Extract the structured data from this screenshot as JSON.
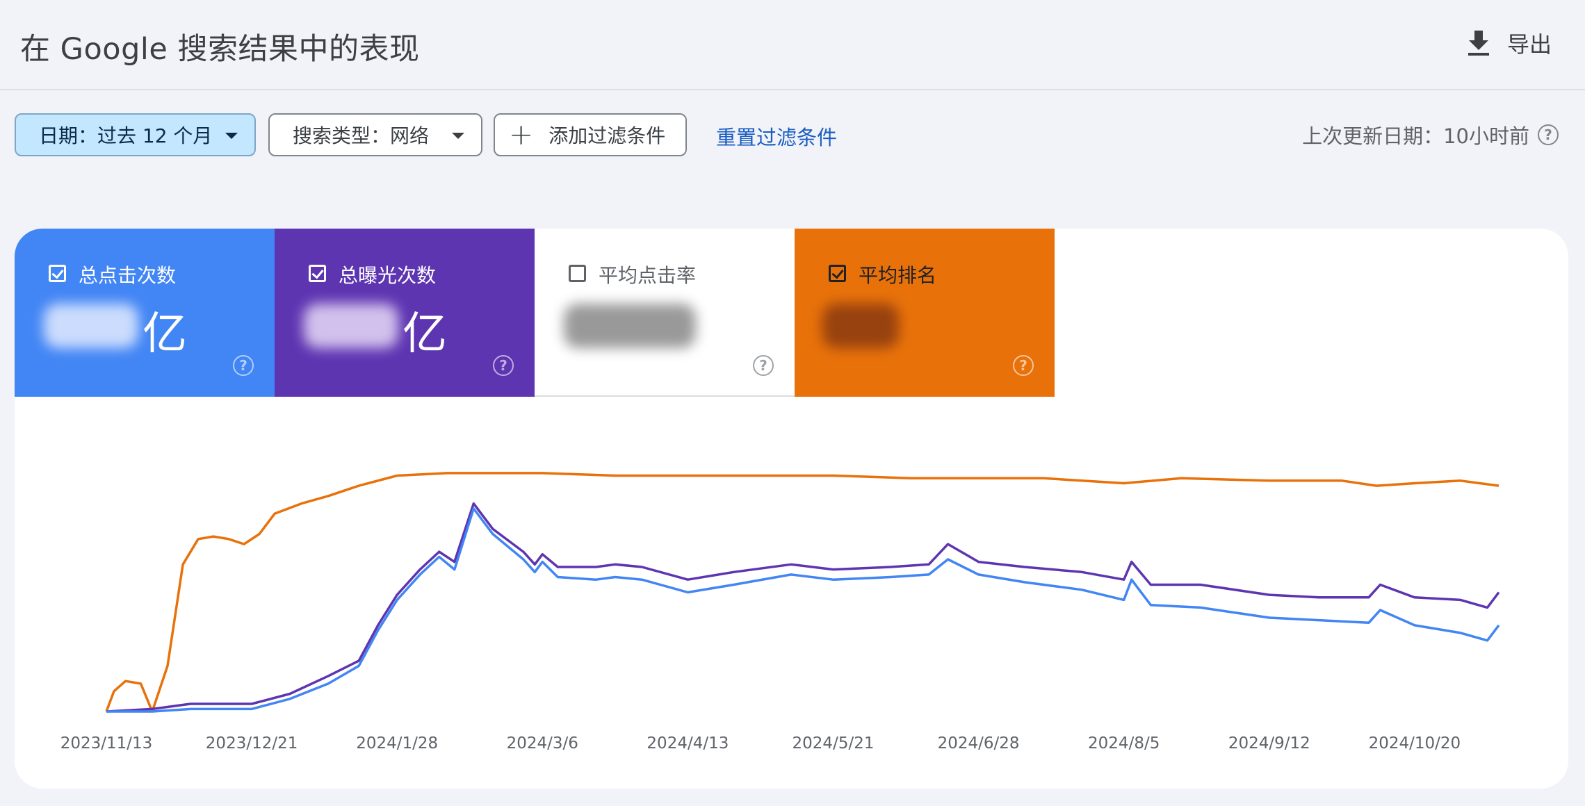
{
  "header": {
    "title": "在 Google 搜索结果中的表现",
    "export_label": "导出"
  },
  "filters": {
    "date_label": "日期：过去 12 个月",
    "search_type_label": "搜索类型：网络",
    "add_filter_label": "添加过滤条件",
    "reset_label": "重置过滤条件",
    "last_updated": "上次更新日期：10小时前"
  },
  "metrics": [
    {
      "label": "总点击次数",
      "unit": "亿",
      "checked": true,
      "color": "#4285f4"
    },
    {
      "label": "总曝光次数",
      "unit": "亿",
      "checked": true,
      "color": "#5e35b1"
    },
    {
      "label": "平均点击率",
      "unit": "",
      "checked": false,
      "color": "#ffffff"
    },
    {
      "label": "平均排名",
      "unit": "",
      "checked": true,
      "color": "#e8710a"
    }
  ],
  "icons": {
    "export": "download-icon",
    "add": "plus-icon",
    "help": "help-circle-icon",
    "checkbox": "checkbox-icon",
    "dropdown": "caret-down-icon"
  },
  "chart_data": {
    "type": "line",
    "x_tick_labels": [
      "2023/11/13",
      "2023/12/21",
      "2024/1/28",
      "2024/3/6",
      "2024/4/13",
      "2024/5/21",
      "2024/6/28",
      "2024/8/5",
      "2024/9/12",
      "2024/10/20"
    ],
    "x_range": [
      "2023/11/13",
      "2024/11/11"
    ],
    "y_axis_visible": false,
    "grid": false,
    "note_on_y": "relative scale 0-100, axes not labeled",
    "series": [
      {
        "color": "#e8710a",
        "points": [
          [
            "2023/11/13",
            0
          ],
          [
            "2023/11/15",
            8
          ],
          [
            "2023/11/18",
            12
          ],
          [
            "2023/11/22",
            11
          ],
          [
            "2023/11/25",
            0
          ],
          [
            "2023/11/29",
            18
          ],
          [
            "2023/12/3",
            58
          ],
          [
            "2023/12/7",
            68
          ],
          [
            "2023/12/11",
            69
          ],
          [
            "2023/12/15",
            68
          ],
          [
            "2023/12/19",
            66
          ],
          [
            "2023/12/23",
            70
          ],
          [
            "2023/12/27",
            78
          ],
          [
            "2024/1/3",
            82
          ],
          [
            "2024/1/10",
            85
          ],
          [
            "2024/1/18",
            89
          ],
          [
            "2024/1/28",
            93
          ],
          [
            "2024/2/10",
            94
          ],
          [
            "2024/2/25",
            94
          ],
          [
            "2024/3/6",
            94
          ],
          [
            "2024/3/25",
            93
          ],
          [
            "2024/4/13",
            93
          ],
          [
            "2024/5/3",
            93
          ],
          [
            "2024/5/21",
            93
          ],
          [
            "2024/6/10",
            92
          ],
          [
            "2024/6/28",
            92
          ],
          [
            "2024/7/15",
            92
          ],
          [
            "2024/7/25",
            91
          ],
          [
            "2024/8/5",
            90
          ],
          [
            "2024/8/20",
            92
          ],
          [
            "2024/9/12",
            91
          ],
          [
            "2024/10/1",
            91
          ],
          [
            "2024/10/10",
            89
          ],
          [
            "2024/10/20",
            90
          ],
          [
            "2024/11/1",
            91
          ],
          [
            "2024/11/11",
            89
          ]
        ]
      },
      {
        "color": "#5e35b1",
        "points": [
          [
            "2023/11/13",
            0
          ],
          [
            "2023/11/25",
            1
          ],
          [
            "2023/12/5",
            3
          ],
          [
            "2023/12/21",
            3
          ],
          [
            "2023/12/31",
            7
          ],
          [
            "2024/1/10",
            14
          ],
          [
            "2024/1/18",
            20
          ],
          [
            "2024/1/23",
            34
          ],
          [
            "2024/1/28",
            46
          ],
          [
            "2024/2/3",
            56
          ],
          [
            "2024/2/8",
            63
          ],
          [
            "2024/2/12",
            59
          ],
          [
            "2024/2/17",
            82
          ],
          [
            "2024/2/22",
            72
          ],
          [
            "2024/3/1",
            63
          ],
          [
            "2024/3/4",
            58
          ],
          [
            "2024/3/6",
            62
          ],
          [
            "2024/3/10",
            57
          ],
          [
            "2024/3/20",
            57
          ],
          [
            "2024/3/25",
            58
          ],
          [
            "2024/4/1",
            57
          ],
          [
            "2024/4/13",
            52
          ],
          [
            "2024/4/25",
            55
          ],
          [
            "2024/5/10",
            58
          ],
          [
            "2024/5/21",
            56
          ],
          [
            "2024/6/5",
            57
          ],
          [
            "2024/6/15",
            58
          ],
          [
            "2024/6/20",
            66
          ],
          [
            "2024/6/28",
            59
          ],
          [
            "2024/7/10",
            57
          ],
          [
            "2024/7/25",
            55
          ],
          [
            "2024/8/5",
            52
          ],
          [
            "2024/8/7",
            59
          ],
          [
            "2024/8/12",
            50
          ],
          [
            "2024/8/25",
            50
          ],
          [
            "2024/9/12",
            46
          ],
          [
            "2024/9/25",
            45
          ],
          [
            "2024/10/8",
            45
          ],
          [
            "2024/10/11",
            50
          ],
          [
            "2024/10/20",
            45
          ],
          [
            "2024/11/1",
            44
          ],
          [
            "2024/11/8",
            41
          ],
          [
            "2024/11/11",
            47
          ]
        ]
      },
      {
        "color": "#4285f4",
        "points": [
          [
            "2023/11/13",
            0
          ],
          [
            "2023/11/25",
            0
          ],
          [
            "2023/12/5",
            1
          ],
          [
            "2023/12/21",
            1
          ],
          [
            "2023/12/31",
            5
          ],
          [
            "2024/1/10",
            11
          ],
          [
            "2024/1/18",
            18
          ],
          [
            "2024/1/23",
            32
          ],
          [
            "2024/1/28",
            44
          ],
          [
            "2024/2/3",
            54
          ],
          [
            "2024/2/8",
            61
          ],
          [
            "2024/2/12",
            56
          ],
          [
            "2024/2/17",
            80
          ],
          [
            "2024/2/22",
            70
          ],
          [
            "2024/3/1",
            60
          ],
          [
            "2024/3/4",
            55
          ],
          [
            "2024/3/6",
            59
          ],
          [
            "2024/3/10",
            53
          ],
          [
            "2024/3/20",
            52
          ],
          [
            "2024/3/25",
            53
          ],
          [
            "2024/4/1",
            52
          ],
          [
            "2024/4/13",
            47
          ],
          [
            "2024/4/25",
            50
          ],
          [
            "2024/5/10",
            54
          ],
          [
            "2024/5/21",
            52
          ],
          [
            "2024/6/5",
            53
          ],
          [
            "2024/6/15",
            54
          ],
          [
            "2024/6/20",
            60
          ],
          [
            "2024/6/28",
            54
          ],
          [
            "2024/7/10",
            51
          ],
          [
            "2024/7/25",
            48
          ],
          [
            "2024/8/5",
            44
          ],
          [
            "2024/8/7",
            52
          ],
          [
            "2024/8/12",
            42
          ],
          [
            "2024/8/25",
            41
          ],
          [
            "2024/9/12",
            37
          ],
          [
            "2024/9/25",
            36
          ],
          [
            "2024/10/8",
            35
          ],
          [
            "2024/10/11",
            40
          ],
          [
            "2024/10/20",
            34
          ],
          [
            "2024/11/1",
            31
          ],
          [
            "2024/11/8",
            28
          ],
          [
            "2024/11/11",
            34
          ]
        ]
      }
    ]
  }
}
